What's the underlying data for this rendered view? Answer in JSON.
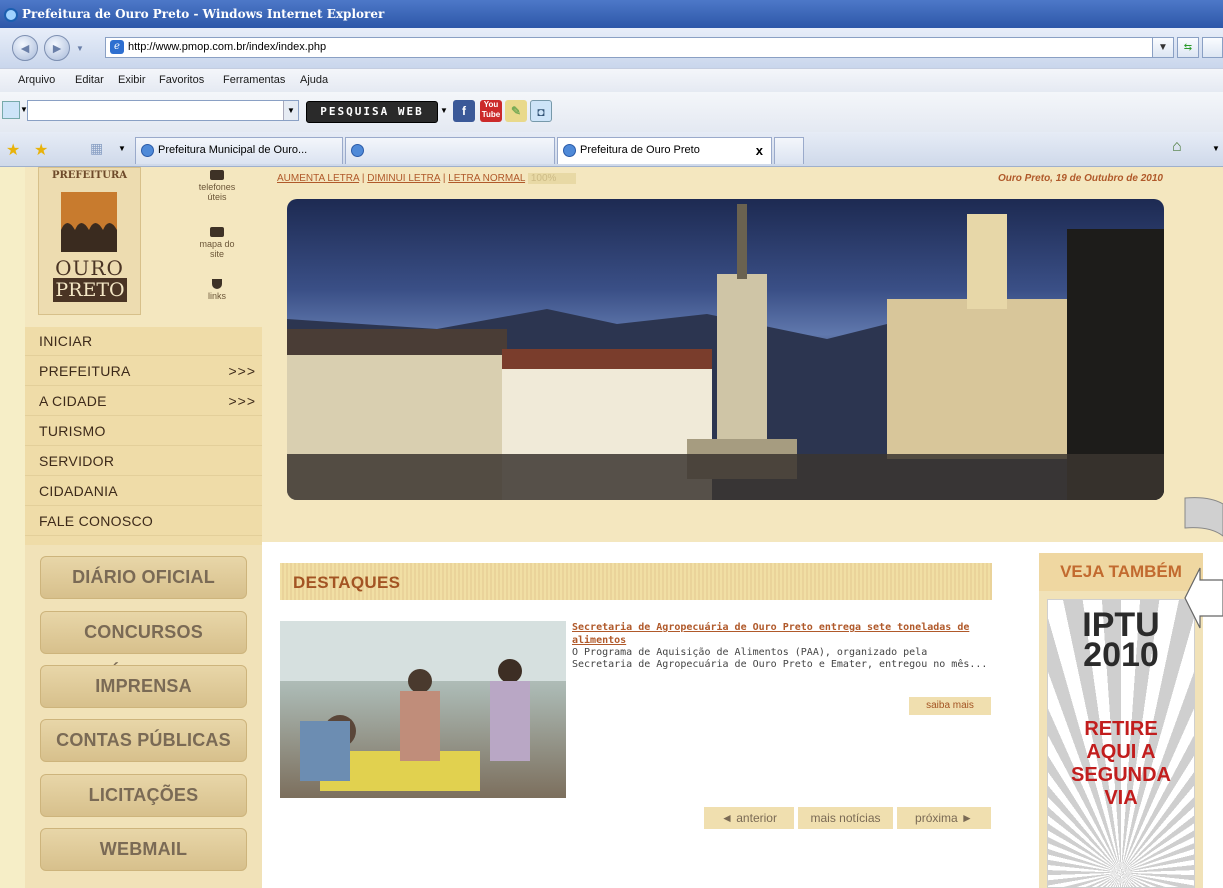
{
  "window": {
    "title": "Prefeitura de Ouro Preto - Windows Internet Explorer"
  },
  "address": {
    "url": "http://www.pmop.com.br/index/index.php"
  },
  "menu": [
    "Arquivo",
    "Editar",
    "Exibir",
    "Favoritos",
    "Ferramentas",
    "Ajuda"
  ],
  "toolbar": {
    "search_button": "PESQUISA WEB"
  },
  "tabs": [
    {
      "label": "Prefeitura Municipal de Ouro..."
    },
    {
      "label": ""
    },
    {
      "label": "Prefeitura de Ouro Preto",
      "close": "x"
    }
  ],
  "site": {
    "logo_top": "PREFEITURA",
    "logo_ouro": "OURO",
    "logo_preto": "PRETO",
    "tools": [
      {
        "label_1": "telefones",
        "label_2": "úteis",
        "icon": "telephone-icon"
      },
      {
        "label_1": "mapa do",
        "label_2": "site",
        "icon": "sitemap-icon"
      },
      {
        "label_1": "links",
        "label_2": "",
        "icon": "links-icon"
      }
    ],
    "font_controls": {
      "increase": "AUMENTA LETRA",
      "decrease": "DIMINUI LETRA",
      "normal": "LETRA NORMAL",
      "separator": "|",
      "zoom": "100%"
    },
    "date": "Ouro Preto, 19 de Outubro de 2010",
    "nav": [
      {
        "label": "INICIAR",
        "arrow": ""
      },
      {
        "label": "PREFEITURA",
        "arrow": ">>>"
      },
      {
        "label": "A CIDADE",
        "arrow": ">>>"
      },
      {
        "label": "TURISMO",
        "arrow": ""
      },
      {
        "label": "SERVIDOR",
        "arrow": ""
      },
      {
        "label": "CIDADANIA",
        "arrow": ""
      },
      {
        "label": "FALE CONOSCO",
        "arrow": ""
      }
    ],
    "big_buttons": [
      "DIÁRIO OFICIAL",
      "CONCURSOS PÚBLICOS",
      "IMPRENSA",
      "CONTAS PÚBLICAS",
      "LICITAÇÕES",
      "WEBMAIL"
    ],
    "destaques": {
      "heading": "DESTAQUES",
      "news_title": "Secretaria de Agropecuária de Ouro Preto entrega sete toneladas de alimentos",
      "news_body": "O Programa de Aquisição de Alimentos (PAA), organizado pela Secretaria de Agropecuária de Ouro Preto e Emater, entregou no mês...",
      "more": "saiba mais",
      "prev": "◄ anterior",
      "all": "mais notícias",
      "next": "próxima ►"
    },
    "veja": {
      "heading": "VEJA TAMBÉM",
      "banner_line1": "IPTU",
      "banner_line2": "2010",
      "banner_line3": "RETIRE",
      "banner_line4": "AQUI A",
      "banner_line5": "SEGUNDA",
      "banner_line6": "VIA"
    }
  }
}
